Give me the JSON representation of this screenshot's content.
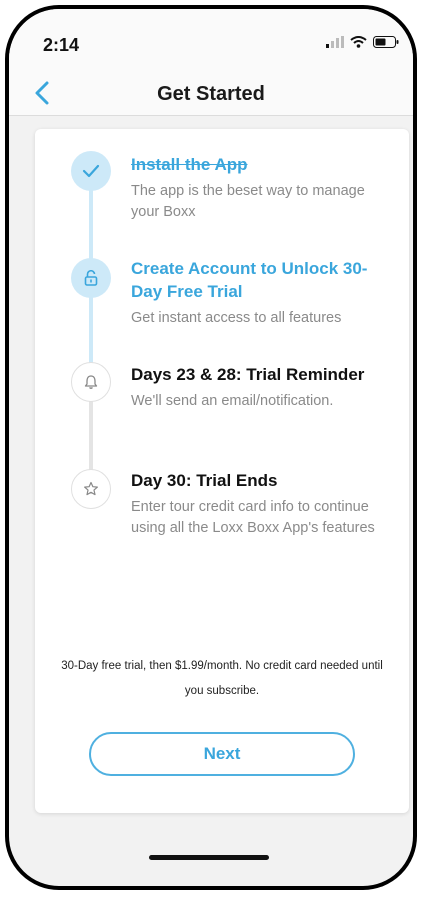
{
  "status_bar": {
    "time": "2:14"
  },
  "nav": {
    "title": "Get Started"
  },
  "steps": [
    {
      "title": "Install the App",
      "desc": "The app is the beset way to manage your Boxx",
      "state": "completed",
      "icon": "check-icon"
    },
    {
      "title": "Create Account to Unlock 30-Day Free Trial",
      "desc": "Get instant access to all features",
      "state": "current",
      "icon": "lock-icon"
    },
    {
      "title": "Days 23 & 28: Trial Reminder",
      "desc": "We'll send an email/notification.",
      "state": "upcoming",
      "icon": "bell-icon"
    },
    {
      "title": "Day 30: Trial Ends",
      "desc": "Enter tour credit card info to continue using all the Loxx Boxx App's features",
      "state": "upcoming",
      "icon": "star-icon"
    }
  ],
  "note": "30-Day free trial, then $1.99/month. No credit card needed until you subscribe.",
  "next_button": "Next",
  "colors": {
    "accent": "#3aa6dc",
    "accent_light": "#cde9f8",
    "muted_text": "#8a8a8a"
  }
}
